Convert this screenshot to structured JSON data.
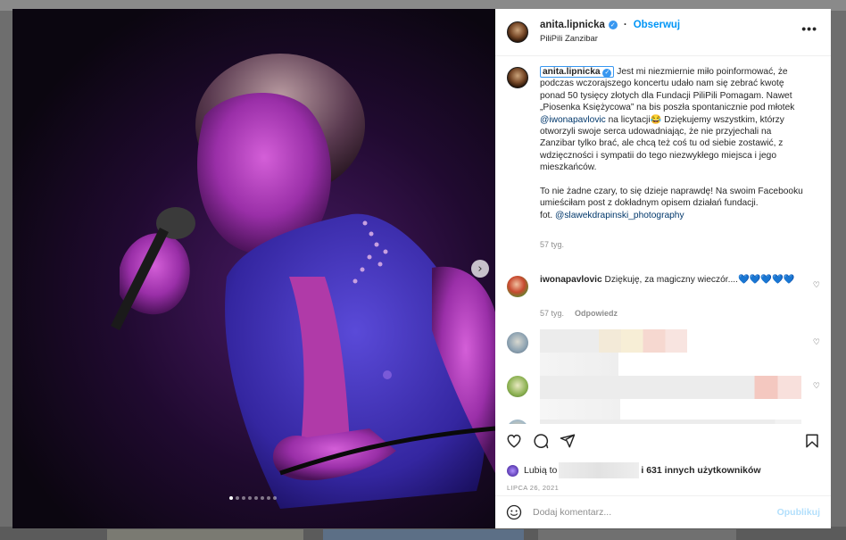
{
  "post": {
    "username": "anita.lipnicka",
    "follow_label": "Obserwuj",
    "location": "PiliPili Zanzibar",
    "more_label": "•••",
    "carousel": {
      "total": 8,
      "active": 1
    }
  },
  "caption": {
    "p1": " Jest mi niezmiernie miło poinformować, że podczas wczorajszego koncertu udało nam się zebrać kwotę ponad 50 tysięcy złotych dla Fundacji PiliPili Pomagam. Nawet „Piosenka Księżycowa” na bis poszła spontanicznie pod młotek ",
    "mention1": "@iwonapavlovic",
    "p2": " na licytacji😂 Dziękujemy wszystkim, którzy otworzyli swoje serca udowadniając, że nie przyjechali na Zanzibar tylko brać, ale chcą też coś tu od siebie zostawić, z wdzięczności i sympatii do tego niezwykłego miejsca i jego mieszkańców.",
    "p3": "To nie żadne czary, to się dzieje naprawdę! Na swoim Facebooku umieściłam post z dokładnym opisem działań fundacji.",
    "p4_prefix": "fot. ",
    "mention2": "@slawekdrapinski_photography",
    "time": "57 tyg."
  },
  "comment": {
    "username": "iwonapavlovic",
    "text": " Dziękuję, za magiczny wieczór....💙💙💙💙💙",
    "time": "57 tyg.",
    "reply_label": "Odpowiedz"
  },
  "likes": {
    "prefix": "Lubią to",
    "suffix": "i 631 innych użytkowników"
  },
  "date": "LIPCA 26, 2021",
  "add_comment": {
    "placeholder": "Dodaj komentarz...",
    "publish_label": "Opublikuj"
  },
  "colors": {
    "accent": "#0095f6",
    "publish_disabled": "#b2dffc",
    "verified": "#3897f0"
  },
  "icons": [
    "verified-badge-icon",
    "more-options-icon",
    "next-arrow-icon",
    "heart-icon",
    "comment-icon",
    "share-icon",
    "bookmark-icon",
    "emoji-icon"
  ]
}
